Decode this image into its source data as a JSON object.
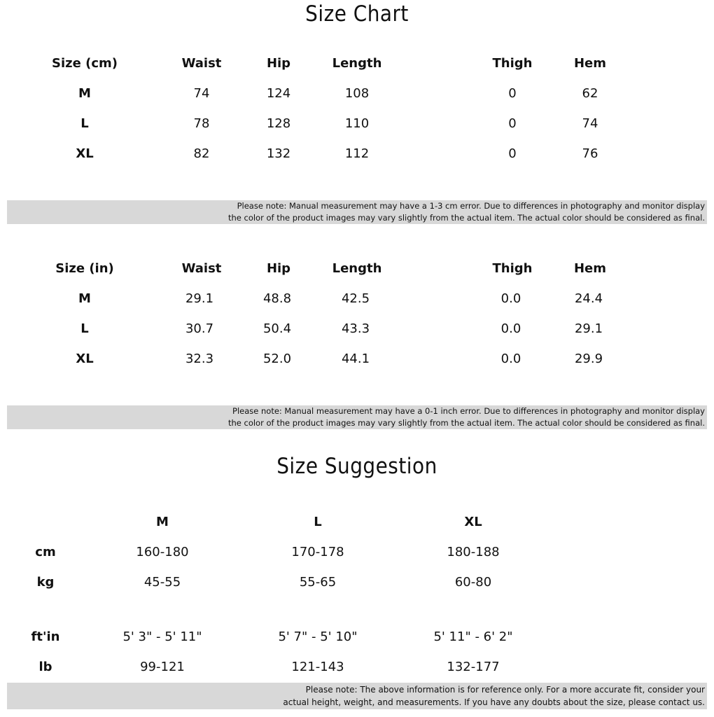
{
  "size_chart": {
    "title": "Size Chart",
    "cm_table": {
      "headers": [
        "Size (cm)",
        "Waist",
        "Hip",
        "Length",
        "Thigh",
        "Hem"
      ],
      "rows": [
        {
          "size": "M",
          "values": [
            "74",
            "124",
            "108",
            "0",
            "62"
          ]
        },
        {
          "size": "L",
          "values": [
            "78",
            "128",
            "110",
            "0",
            "74"
          ]
        },
        {
          "size": "XL",
          "values": [
            "82",
            "132",
            "112",
            "0",
            "76"
          ]
        }
      ],
      "note": {
        "line1": "Please note: Manual measurement may have a 1-3 cm error. Due to differences in photography and monitor display",
        "line2": "the color of the product images may vary slightly from the actual item. The actual color should be considered as final."
      }
    },
    "in_table": {
      "headers": [
        "Size (in)",
        "Waist",
        "Hip",
        "Length",
        "Thigh",
        "Hem"
      ],
      "rows": [
        {
          "size": "M",
          "values": [
            "29.1",
            "48.8",
            "42.5",
            "0.0",
            "24.4"
          ]
        },
        {
          "size": "L",
          "values": [
            "30.7",
            "50.4",
            "43.3",
            "0.0",
            "29.1"
          ]
        },
        {
          "size": "XL",
          "values": [
            "32.3",
            "52.0",
            "44.1",
            "0.0",
            "29.9"
          ]
        }
      ],
      "note": {
        "line1": "Please note: Manual measurement may have a 0-1 inch error. Due to differences in photography and monitor display",
        "line2": "the color of the product images may vary slightly from the actual item. The actual color should be considered as final."
      }
    }
  },
  "size_suggestion": {
    "title": "Size Suggestion",
    "columns": [
      "M",
      "L",
      "XL"
    ],
    "rows": [
      {
        "label": "cm",
        "values": [
          "160-180",
          "170-178",
          "180-188"
        ]
      },
      {
        "label": "kg",
        "values": [
          "45-55",
          "55-65",
          "60-80"
        ]
      },
      {
        "label": "ft'in",
        "values": [
          "5' 3\" - 5' 11\"",
          "5' 7\" - 5' 10\"",
          "5' 11\" - 6' 2\""
        ]
      },
      {
        "label": "lb",
        "values": [
          "99-121",
          "121-143",
          "132-177"
        ]
      }
    ],
    "note": {
      "line1": "Please note: The above information is for reference only. For a more accurate fit, consider your",
      "line2": "actual height, weight, and measurements. If you have any doubts about the size, please contact us."
    }
  },
  "colors": {
    "text": "#111111",
    "note_background": "#d8d8d8",
    "page_background": "#ffffff"
  }
}
